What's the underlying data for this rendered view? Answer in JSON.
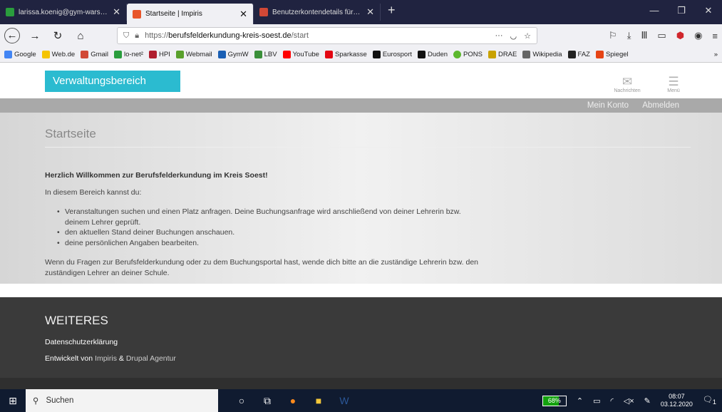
{
  "browser": {
    "tabs": [
      {
        "title": "larissa.koenig@gym-warstein.n",
        "favicon_color": "#2a9d3d",
        "close": "✕",
        "active": false
      },
      {
        "title": "Startseite | Impiris",
        "favicon_color": "#e8552a",
        "close": "✕",
        "active": true
      },
      {
        "title": "Benutzerkontendetails für lariss",
        "favicon_color": "#d14836",
        "close": "✕",
        "active": false
      }
    ],
    "new_tab": "+",
    "url_prefix": "https://",
    "url_domain": "berufsfelderkundung-kreis-soest.de",
    "url_path": "/start",
    "url_menu": "···",
    "bookmarks": [
      {
        "label": "Google",
        "color": "#4285f4"
      },
      {
        "label": "Web.de",
        "color": "#f5c400"
      },
      {
        "label": "Gmail",
        "color": "#d14836"
      },
      {
        "label": "lo-net²",
        "color": "#2a9d3d"
      },
      {
        "label": "HPI",
        "color": "#b01e2e"
      },
      {
        "label": "Webmail",
        "color": "#5aa02c"
      },
      {
        "label": "GymW",
        "color": "#1a5fb4"
      },
      {
        "label": "LBV",
        "color": "#3a8f3a"
      },
      {
        "label": "YouTube",
        "color": "#ff0000"
      },
      {
        "label": "Sparkasse",
        "color": "#e30613"
      },
      {
        "label": "Eurosport",
        "color": "#111111"
      },
      {
        "label": "Duden",
        "color": "#111111"
      },
      {
        "label": "PONS",
        "color": "#5cb82e"
      },
      {
        "label": "DRAE",
        "color": "#c9a200"
      },
      {
        "label": "Wikipedia",
        "color": "#666666"
      },
      {
        "label": "FAZ",
        "color": "#222222"
      },
      {
        "label": "Spiegel",
        "color": "#e64415"
      }
    ],
    "bookmarks_more": "»"
  },
  "site": {
    "admin_button": "Verwaltungsbereich",
    "messages_label": "Nachrichten",
    "menu_label": "Menü",
    "nav": {
      "account": "Mein Konto",
      "logout": "Abmelden"
    },
    "page_title": "Startseite",
    "welcome": "Herzlich Willkommen zur Berufsfelderkundung im Kreis Soest!",
    "intro": "In diesem Bereich kannst du:",
    "bullets": [
      "Veranstaltungen suchen und einen Platz anfragen. Deine Buchungsanfrage wird anschließend von deiner Lehrerin bzw. deinem Lehrer geprüft.",
      "den aktuellen Stand deiner Buchungen anschauen.",
      "deine persönlichen Angaben bearbeiten."
    ],
    "outro": "Wenn du Fragen zur Berufsfelderkundung oder zu dem Buchungsportal hast, wende dich bitte an die zuständige Lehrerin bzw. den zuständigen Lehrer an deiner Schule.",
    "footer": {
      "heading": "WEITERES",
      "privacy": "Datenschutzerklärung",
      "dev_prefix": "Entwickelt von",
      "dev_link1": "Impiris",
      "dev_amp": "&",
      "dev_link2": "Drupal Agentur"
    }
  },
  "taskbar": {
    "search_placeholder": "Suchen",
    "battery": "68%",
    "battery_level": 0.68,
    "time": "08:07",
    "date": "03.12.2020",
    "notification_count": "1"
  }
}
